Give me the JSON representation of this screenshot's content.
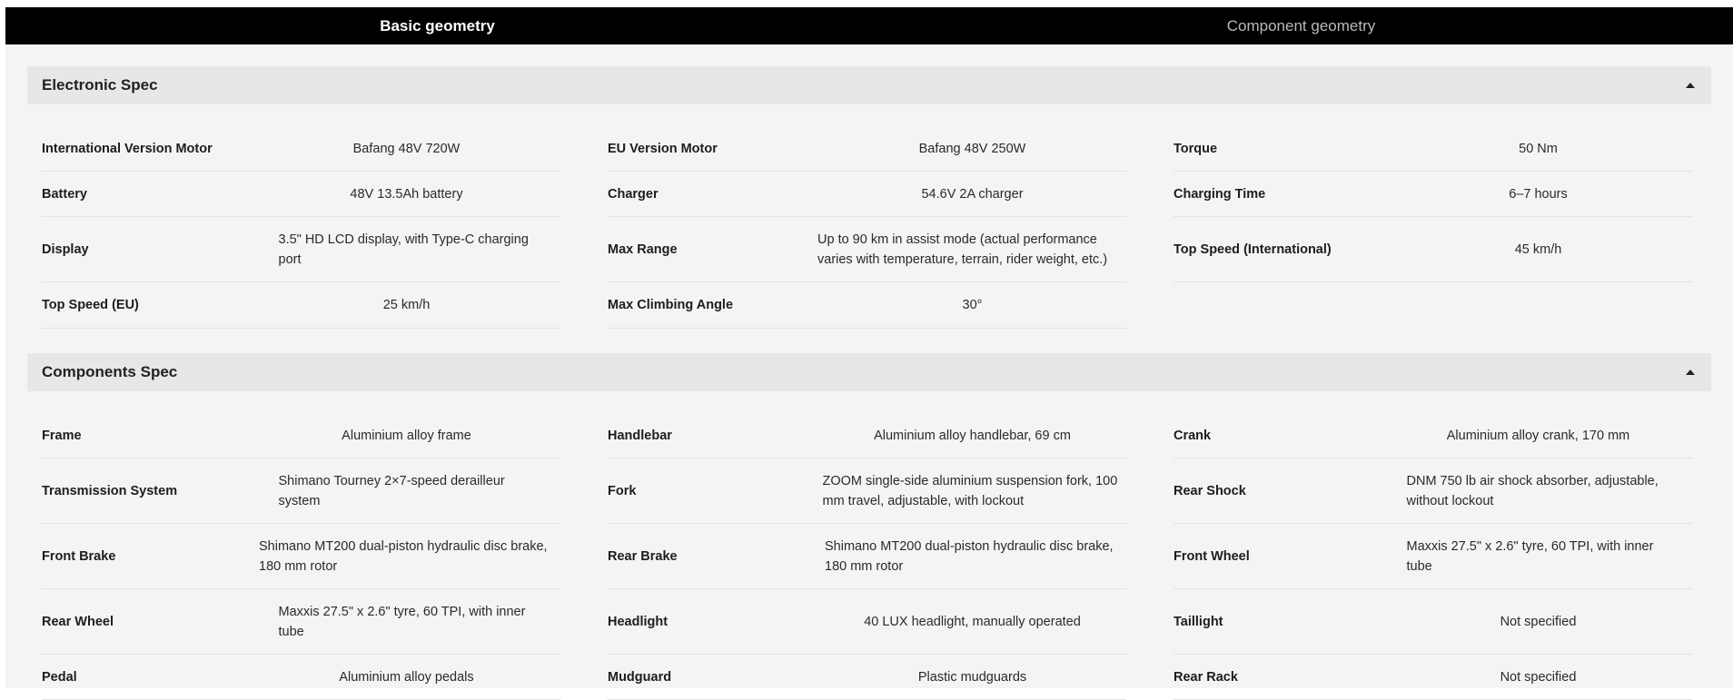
{
  "tabs": [
    {
      "label": "Basic geometry",
      "active": true
    },
    {
      "label": "Component geometry",
      "active": false
    }
  ],
  "sections": [
    {
      "title": "Electronic Spec",
      "columns": [
        [
          {
            "label": "International Version Motor",
            "value": "Bafang 48V 720W"
          },
          {
            "label": "Battery",
            "value": "48V 13.5Ah battery"
          },
          {
            "label": "Display",
            "value": "3.5\" HD LCD display, with Type-C charging port"
          },
          {
            "label": "Top Speed (EU)",
            "value": "25 km/h"
          }
        ],
        [
          {
            "label": "EU Version Motor",
            "value": "Bafang 48V 250W"
          },
          {
            "label": "Charger",
            "value": "54.6V 2A charger"
          },
          {
            "label": "Max Range",
            "value": "Up to 90 km in assist mode (actual performance varies with temperature, terrain, rider weight, etc.)"
          },
          {
            "label": "Max Climbing Angle",
            "value": "30°"
          }
        ],
        [
          {
            "label": "Torque",
            "value": "50 Nm"
          },
          {
            "label": "Charging Time",
            "value": "6–7 hours"
          },
          {
            "label": "Top Speed (International)",
            "value": "45 km/h"
          }
        ]
      ]
    },
    {
      "title": "Components Spec",
      "columns": [
        [
          {
            "label": "Frame",
            "value": "Aluminium alloy frame"
          },
          {
            "label": "Transmission System",
            "value": "Shimano Tourney 2×7-speed derailleur system"
          },
          {
            "label": "Front Brake",
            "value": "Shimano MT200 dual-piston hydraulic disc brake, 180 mm rotor"
          },
          {
            "label": "Rear Wheel",
            "value": "Maxxis 27.5\" x 2.6\" tyre, 60 TPI, with inner tube"
          },
          {
            "label": "Pedal",
            "value": "Aluminium alloy pedals"
          }
        ],
        [
          {
            "label": "Handlebar",
            "value": "Aluminium alloy handlebar, 69 cm"
          },
          {
            "label": "Fork",
            "value": "ZOOM single-side aluminium suspension fork, 100 mm travel, adjustable, with lockout"
          },
          {
            "label": "Rear Brake",
            "value": "Shimano MT200 dual-piston hydraulic disc brake, 180 mm rotor"
          },
          {
            "label": "Headlight",
            "value": "40 LUX headlight, manually operated"
          },
          {
            "label": "Mudguard",
            "value": "Plastic mudguards"
          }
        ],
        [
          {
            "label": "Crank",
            "value": "Aluminium alloy crank, 170 mm"
          },
          {
            "label": "Rear Shock",
            "value": "DNM 750 lb air shock absorber, adjustable, without lockout"
          },
          {
            "label": "Front Wheel",
            "value": "Maxxis 27.5\" x 2.6\" tyre, 60 TPI, with inner tube"
          },
          {
            "label": "Taillight",
            "value": "Not specified"
          },
          {
            "label": "Rear Rack",
            "value": "Not specified"
          }
        ]
      ]
    }
  ]
}
